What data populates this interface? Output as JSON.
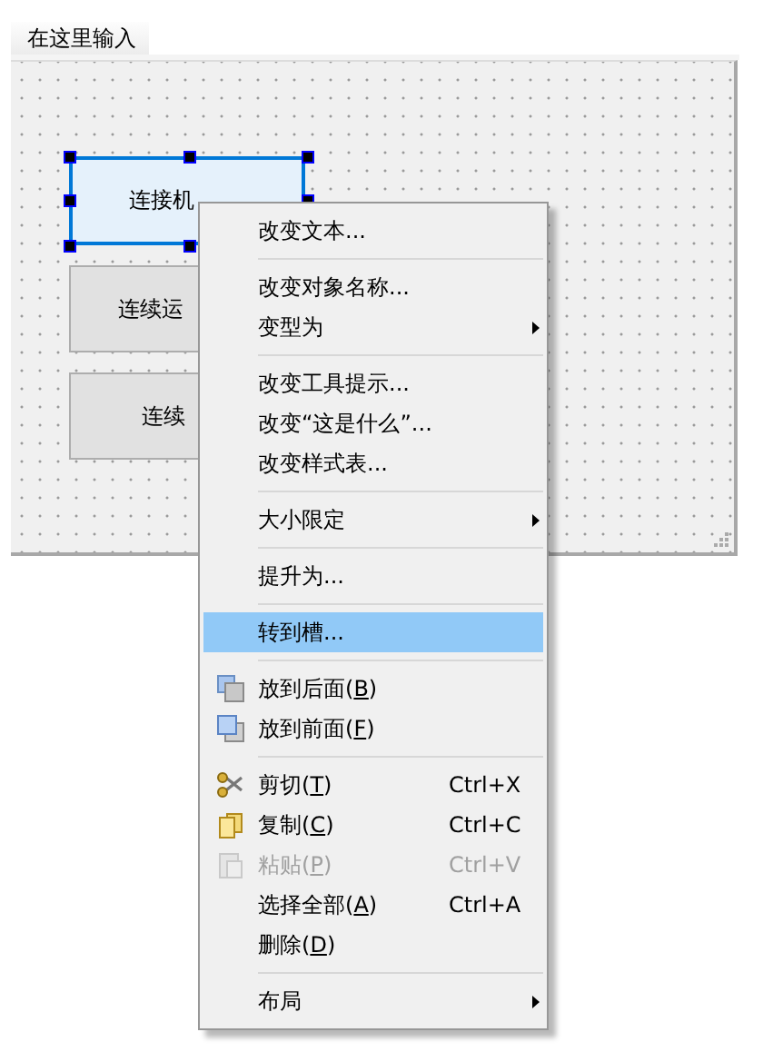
{
  "menubar": {
    "items": [
      "在这里输入"
    ]
  },
  "form": {
    "buttons": [
      {
        "label": "连接机",
        "selected": true
      },
      {
        "label": "连续运",
        "selected": false
      },
      {
        "label": "连续",
        "selected": false
      }
    ]
  },
  "context_menu": {
    "items": [
      {
        "kind": "action",
        "label": "改变文本...",
        "selected": false,
        "disabled": false
      },
      {
        "kind": "separator"
      },
      {
        "kind": "action",
        "label": "改变对象名称...",
        "selected": false,
        "disabled": false
      },
      {
        "kind": "action",
        "label": "变型为",
        "selected": false,
        "disabled": false,
        "submenu": true
      },
      {
        "kind": "separator"
      },
      {
        "kind": "action",
        "label": "改变工具提示...",
        "selected": false,
        "disabled": false
      },
      {
        "kind": "action",
        "label": "改变“这是什么”...",
        "selected": false,
        "disabled": false
      },
      {
        "kind": "action",
        "label": "改变样式表...",
        "selected": false,
        "disabled": false
      },
      {
        "kind": "separator"
      },
      {
        "kind": "action",
        "label": "大小限定",
        "selected": false,
        "disabled": false,
        "submenu": true
      },
      {
        "kind": "separator"
      },
      {
        "kind": "action",
        "label": "提升为...",
        "selected": false,
        "disabled": false
      },
      {
        "kind": "separator"
      },
      {
        "kind": "action",
        "label": "转到槽...",
        "selected": true,
        "disabled": false
      },
      {
        "kind": "separator"
      },
      {
        "kind": "send-back",
        "label": "放到后面(B)",
        "selected": false,
        "disabled": false,
        "mnemonic": true
      },
      {
        "kind": "bring-front",
        "label": "放到前面(F)",
        "selected": false,
        "disabled": false,
        "mnemonic": true
      },
      {
        "kind": "separator"
      },
      {
        "kind": "cut",
        "label": "剪切(T)",
        "selected": false,
        "disabled": false,
        "mnemonic": true,
        "shortcut": "Ctrl+X"
      },
      {
        "kind": "copy",
        "label": "复制(C)",
        "selected": false,
        "disabled": false,
        "mnemonic": true,
        "shortcut": "Ctrl+C"
      },
      {
        "kind": "paste",
        "label": "粘贴(P)",
        "selected": false,
        "disabled": true,
        "mnemonic": true,
        "shortcut": "Ctrl+V"
      },
      {
        "kind": "action",
        "label": "选择全部(A)",
        "selected": false,
        "disabled": false,
        "mnemonic": true,
        "shortcut": "Ctrl+A"
      },
      {
        "kind": "action",
        "label": "删除(D)",
        "selected": false,
        "disabled": false,
        "mnemonic": true
      },
      {
        "kind": "separator"
      },
      {
        "kind": "action",
        "label": "布局",
        "selected": false,
        "disabled": false,
        "submenu": true
      }
    ]
  }
}
